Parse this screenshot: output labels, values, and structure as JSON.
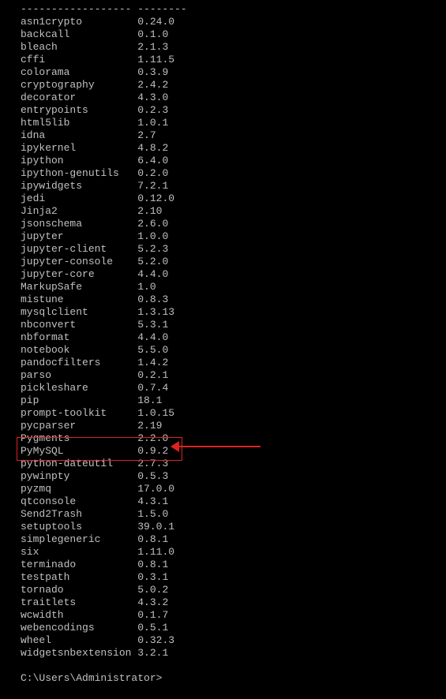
{
  "header": {
    "name_dashes": "------------------",
    "ver_dashes": "--------"
  },
  "packages": [
    {
      "name": "asn1crypto",
      "version": "0.24.0"
    },
    {
      "name": "backcall",
      "version": "0.1.0"
    },
    {
      "name": "bleach",
      "version": "2.1.3"
    },
    {
      "name": "cffi",
      "version": "1.11.5"
    },
    {
      "name": "colorama",
      "version": "0.3.9"
    },
    {
      "name": "cryptography",
      "version": "2.4.2"
    },
    {
      "name": "decorator",
      "version": "4.3.0"
    },
    {
      "name": "entrypoints",
      "version": "0.2.3"
    },
    {
      "name": "html5lib",
      "version": "1.0.1"
    },
    {
      "name": "idna",
      "version": "2.7"
    },
    {
      "name": "ipykernel",
      "version": "4.8.2"
    },
    {
      "name": "ipython",
      "version": "6.4.0"
    },
    {
      "name": "ipython-genutils",
      "version": "0.2.0"
    },
    {
      "name": "ipywidgets",
      "version": "7.2.1"
    },
    {
      "name": "jedi",
      "version": "0.12.0"
    },
    {
      "name": "Jinja2",
      "version": "2.10"
    },
    {
      "name": "jsonschema",
      "version": "2.6.0"
    },
    {
      "name": "jupyter",
      "version": "1.0.0"
    },
    {
      "name": "jupyter-client",
      "version": "5.2.3"
    },
    {
      "name": "jupyter-console",
      "version": "5.2.0"
    },
    {
      "name": "jupyter-core",
      "version": "4.4.0"
    },
    {
      "name": "MarkupSafe",
      "version": "1.0"
    },
    {
      "name": "mistune",
      "version": "0.8.3"
    },
    {
      "name": "mysqlclient",
      "version": "1.3.13"
    },
    {
      "name": "nbconvert",
      "version": "5.3.1"
    },
    {
      "name": "nbformat",
      "version": "4.4.0"
    },
    {
      "name": "notebook",
      "version": "5.5.0"
    },
    {
      "name": "pandocfilters",
      "version": "1.4.2"
    },
    {
      "name": "parso",
      "version": "0.2.1"
    },
    {
      "name": "pickleshare",
      "version": "0.7.4"
    },
    {
      "name": "pip",
      "version": "18.1"
    },
    {
      "name": "prompt-toolkit",
      "version": "1.0.15"
    },
    {
      "name": "pycparser",
      "version": "2.19"
    },
    {
      "name": "Pygments",
      "version": "2.2.0"
    },
    {
      "name": "PyMySQL",
      "version": "0.9.2"
    },
    {
      "name": "python-dateutil",
      "version": "2.7.3"
    },
    {
      "name": "pywinpty",
      "version": "0.5.3"
    },
    {
      "name": "pyzmq",
      "version": "17.0.0"
    },
    {
      "name": "qtconsole",
      "version": "4.3.1"
    },
    {
      "name": "Send2Trash",
      "version": "1.5.0"
    },
    {
      "name": "setuptools",
      "version": "39.0.1"
    },
    {
      "name": "simplegeneric",
      "version": "0.8.1"
    },
    {
      "name": "six",
      "version": "1.11.0"
    },
    {
      "name": "terminado",
      "version": "0.8.1"
    },
    {
      "name": "testpath",
      "version": "0.3.1"
    },
    {
      "name": "tornado",
      "version": "5.0.2"
    },
    {
      "name": "traitlets",
      "version": "4.3.2"
    },
    {
      "name": "wcwidth",
      "version": "0.1.7"
    },
    {
      "name": "webencodings",
      "version": "0.5.1"
    },
    {
      "name": "wheel",
      "version": "0.32.3"
    },
    {
      "name": "widgetsnbextension",
      "version": "3.2.1"
    }
  ],
  "prompt": "C:\\Users\\Administrator>"
}
